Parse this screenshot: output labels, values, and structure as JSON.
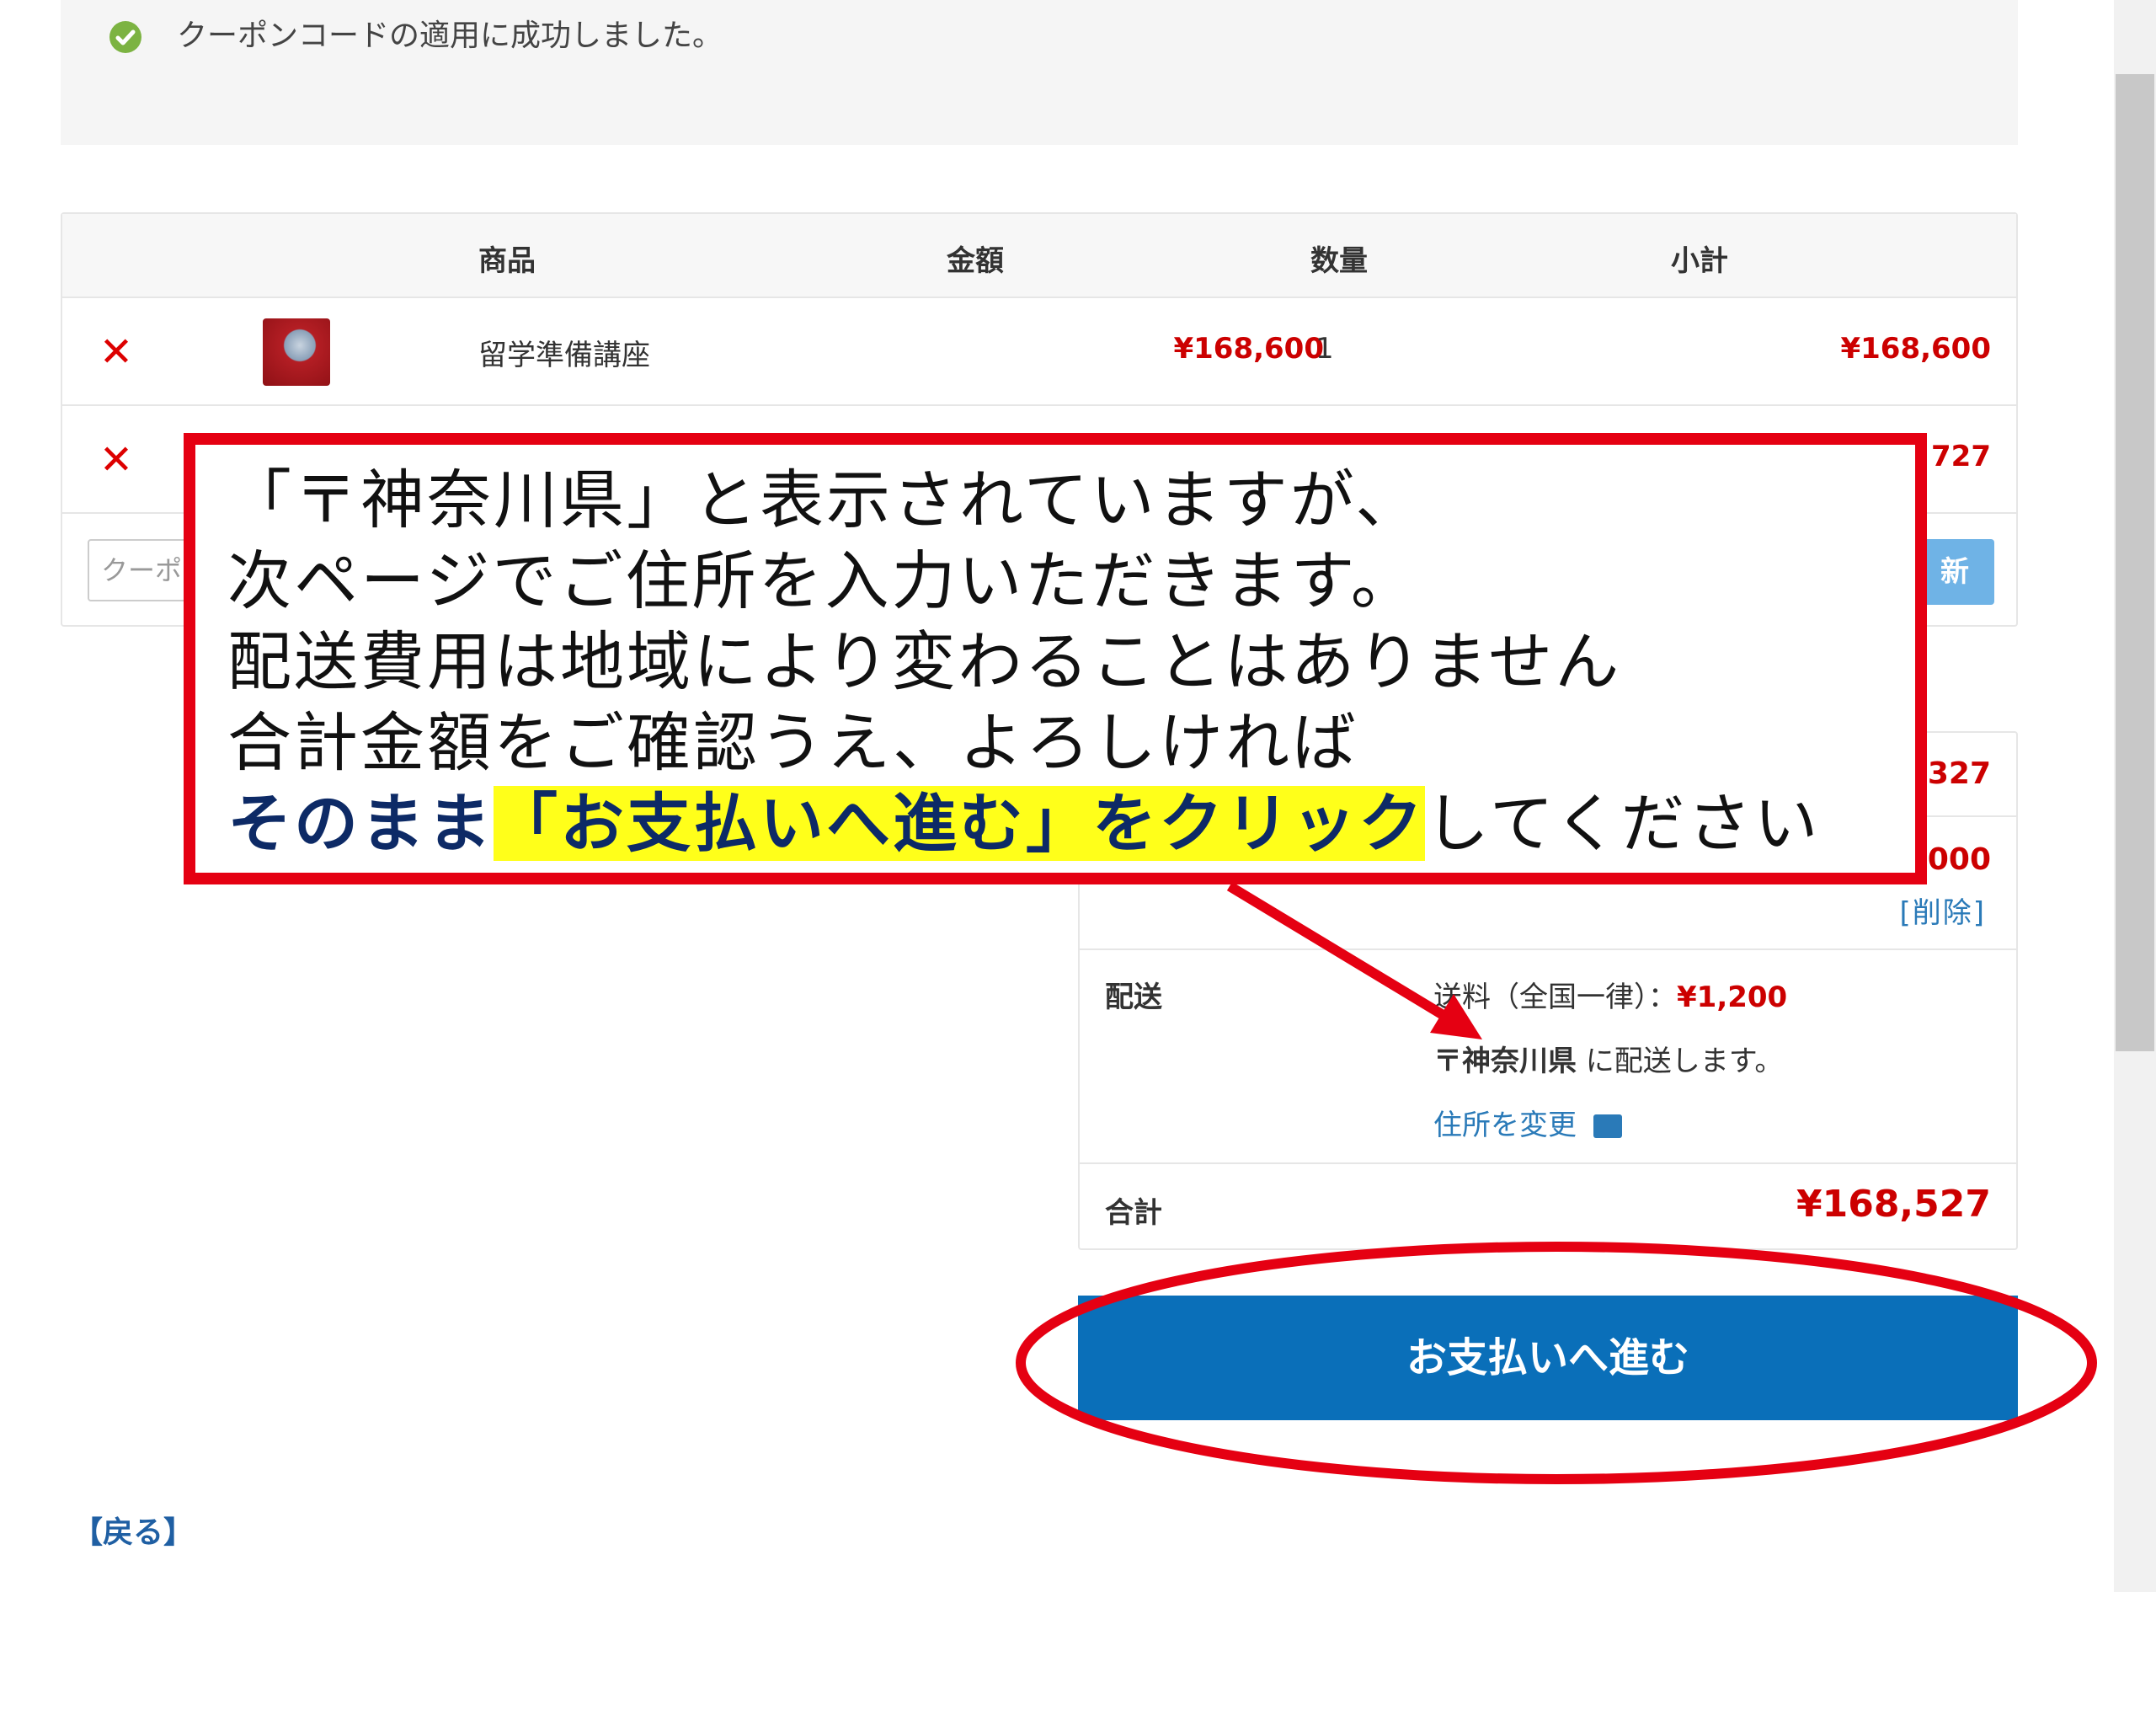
{
  "notice": {
    "text": "クーポンコードの適用に成功しました。"
  },
  "cart": {
    "headers": {
      "product": "商品",
      "price": "金額",
      "qty": "数量",
      "subtotal": "小計"
    },
    "rows": [
      {
        "name": "留学準備講座",
        "price": "¥168,600",
        "qty": "1",
        "subtotal": "¥168,600"
      },
      {
        "subtotal_partial": "727"
      }
    ],
    "coupon_placeholder": "クーポ",
    "update_label": "新"
  },
  "totals": {
    "subtotal_partial": "327",
    "coupon_partial": "000",
    "coupon_delete": "[削除]",
    "shipping_label": "配送",
    "shipping_method": "送料（全国一律）：",
    "shipping_fee": "¥1,200",
    "ship_pref": "〒神奈川県",
    "ship_suffix": " に配送します。",
    "change_address": "住所を変更",
    "total_label": "合計",
    "total_value": "¥168,527"
  },
  "pay_button": "お支払いへ進む",
  "back_link": "【戻る】",
  "callout": {
    "line1": "「〒神奈川県」と表示されていますが、",
    "line2": "次ページでご住所を入力いただきます。",
    "line3": "配送費用は地域により変わることはありません",
    "line4": "合計金額をご確認うえ、よろしければ",
    "line5_bold": "そのまま",
    "line5_highlight": "「お支払いへ進む」をクリック",
    "line5_rest": "してください"
  },
  "colors": {
    "accent_red": "#e50012",
    "button_blue": "#0a6fb9",
    "highlight": "#ffff1a",
    "price_red": "#c00"
  }
}
